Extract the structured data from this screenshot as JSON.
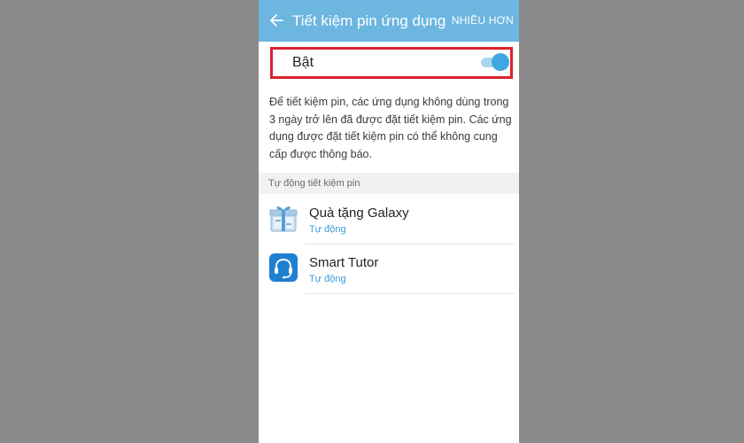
{
  "appbar": {
    "title": "Tiết kiệm pin ứng dụng",
    "more_label": "NHIỀU HƠN",
    "back_icon": "arrow-left-icon",
    "background_color": "#6cb6e0"
  },
  "master_switch": {
    "label": "Bật",
    "state": "on",
    "accent_color": "#3fa6e0",
    "highlight_color": "#d9232e"
  },
  "description": "Để tiết kiệm pin, các ứng dụng không dùng trong 3 ngày trở lên đã được đặt tiết kiệm pin. Các ứng dụng được đặt tiết kiệm pin có thể không cung cấp được thông báo.",
  "section": {
    "header": "Tự động tiết kiệm pin"
  },
  "apps": [
    {
      "name": "Quà tặng Galaxy",
      "status": "Tự động",
      "icon": "gift-box-icon"
    },
    {
      "name": "Smart Tutor",
      "status": "Tự động",
      "icon": "headset-icon"
    }
  ]
}
